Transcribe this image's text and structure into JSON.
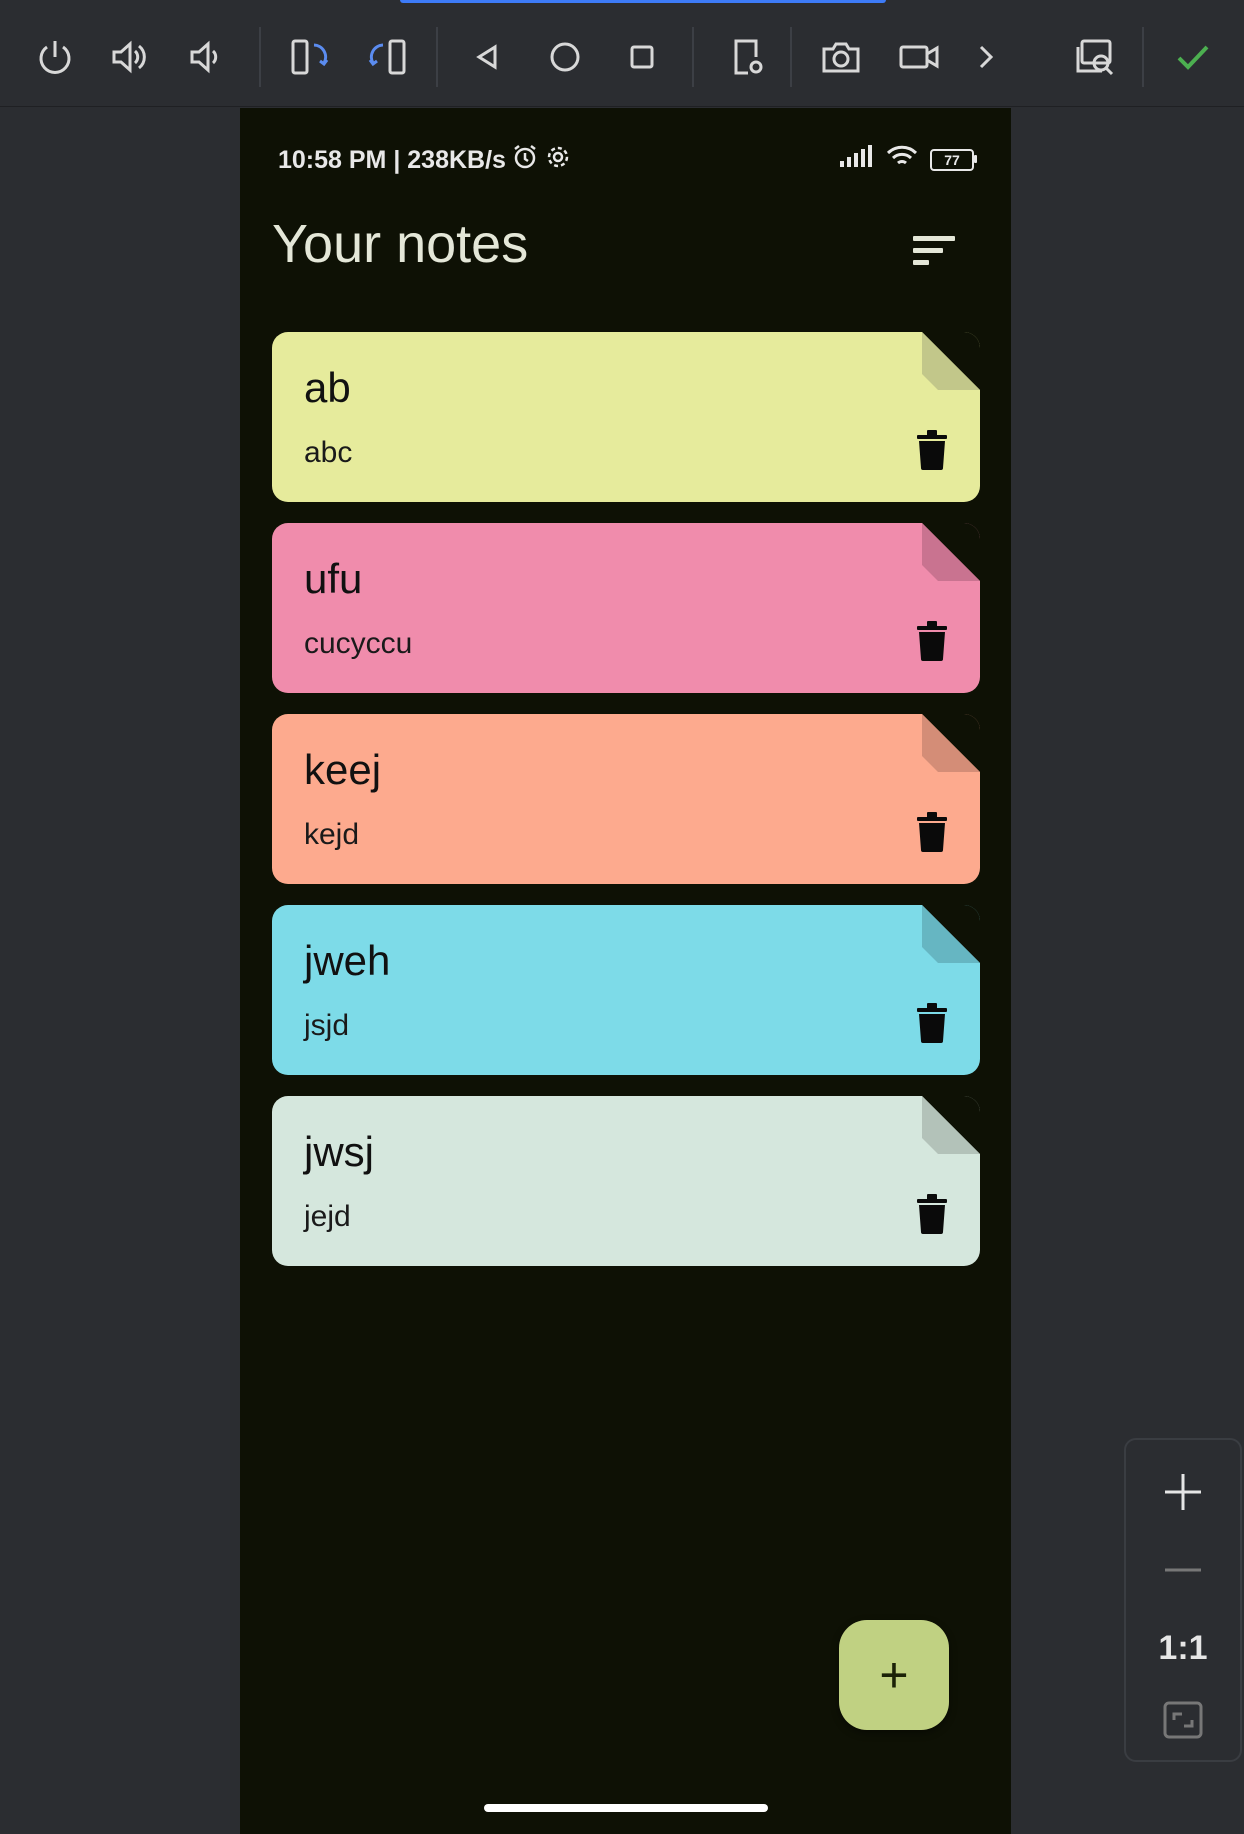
{
  "toolbar": {
    "buttons": [
      "power-icon",
      "volume-up-icon",
      "volume-down-icon",
      "rotate-left-icon",
      "rotate-right-icon",
      "back-icon",
      "home-icon",
      "overview-icon",
      "device-settings-icon",
      "screenshot-icon",
      "screen-record-icon",
      "more-icon",
      "zoom-inspect-icon",
      "check-icon"
    ]
  },
  "status": {
    "time_speed": "10:58 PM | 238KB/s",
    "battery": "77"
  },
  "page": {
    "title": "Your notes"
  },
  "notes": [
    {
      "title": "ab",
      "content": "abc",
      "color": "#e6eb9c",
      "fold": "#c2c78a"
    },
    {
      "title": "ufu",
      "content": "cucyccu",
      "color": "#f08cac",
      "fold": "#c97390"
    },
    {
      "title": "keej",
      "content": "kejd",
      "color": "#fdaa8e",
      "fold": "#d48d77"
    },
    {
      "title": "jweh",
      "content": "jsjd",
      "color": "#7ddbe8",
      "fold": "#66b6c2"
    },
    {
      "title": "jwsj",
      "content": "jejd",
      "color": "#d5e7dd",
      "fold": "#b3c2b9"
    }
  ],
  "fab": {
    "label": "+"
  },
  "zoom": {
    "ratio": "1:1"
  },
  "colors": {
    "background": "#0e1105",
    "fab": "#c0d182",
    "accent": "#3d7bf7",
    "check": "#4caf50"
  }
}
